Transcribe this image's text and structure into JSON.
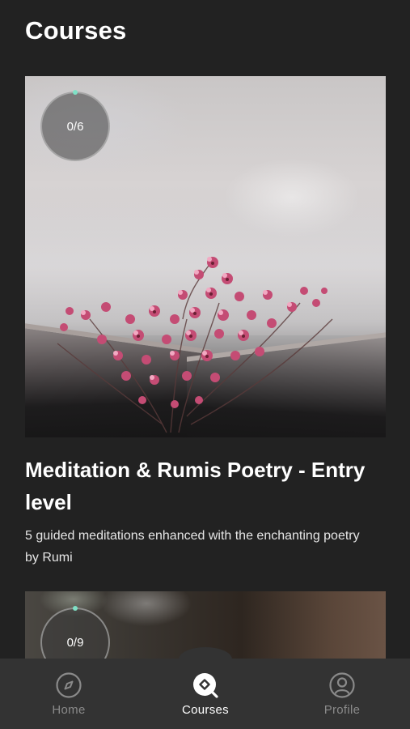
{
  "header": {
    "title": "Courses"
  },
  "courses": [
    {
      "progress_text": "0/6",
      "progress_fraction": 0.0,
      "title": "Meditation & Rumis Poetry - Entry level",
      "description": "5 guided meditations enhanced with the enchanting poetry by Rumi"
    },
    {
      "progress_text": "0/9",
      "progress_fraction": 0.0
    }
  ],
  "nav": {
    "items": [
      {
        "label": "Home",
        "icon": "compass-icon",
        "active": false
      },
      {
        "label": "Courses",
        "icon": "course-search-icon",
        "active": true
      },
      {
        "label": "Profile",
        "icon": "profile-icon",
        "active": false
      }
    ]
  },
  "colors": {
    "background": "#222222",
    "nav_background": "#333333",
    "progress_accent": "#7fe0c6",
    "inactive_nav": "#8a8a8a"
  }
}
